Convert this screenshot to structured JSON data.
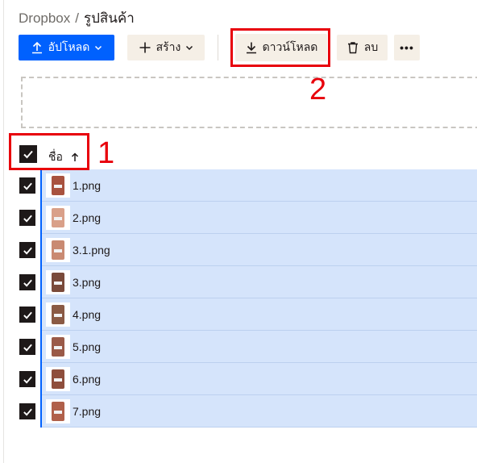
{
  "breadcrumb": {
    "root": "Dropbox",
    "separator": "/",
    "current": "รูปสินค้า"
  },
  "toolbar": {
    "upload_label": "อัปโหลด",
    "create_label": "สร้าง",
    "download_label": "ดาวน์โหลด",
    "delete_label": "ลบ",
    "more_label": "•••"
  },
  "file_list": {
    "column_name": "ชื่อ",
    "sort": "ascending",
    "select_all_checked": true,
    "files": [
      {
        "name": "1.png",
        "checked": true,
        "thumb_color": "#a8523f"
      },
      {
        "name": "2.png",
        "checked": true,
        "thumb_color": "#d9a089"
      },
      {
        "name": "3.1.png",
        "checked": true,
        "thumb_color": "#c98a72"
      },
      {
        "name": "3.png",
        "checked": true,
        "thumb_color": "#7a4a3a"
      },
      {
        "name": "4.png",
        "checked": true,
        "thumb_color": "#8a5a44"
      },
      {
        "name": "5.png",
        "checked": true,
        "thumb_color": "#9a5a48"
      },
      {
        "name": "6.png",
        "checked": true,
        "thumb_color": "#8e4e3c"
      },
      {
        "name": "7.png",
        "checked": true,
        "thumb_color": "#b0604a"
      }
    ]
  },
  "annotations": [
    {
      "number": "1",
      "target": "select-all-and-name-header"
    },
    {
      "number": "2",
      "target": "download-button"
    }
  ],
  "colors": {
    "accent": "#0061fe",
    "selection": "#d5e4fb",
    "annotation": "#e8000b",
    "button_bg": "#f5efe6"
  }
}
